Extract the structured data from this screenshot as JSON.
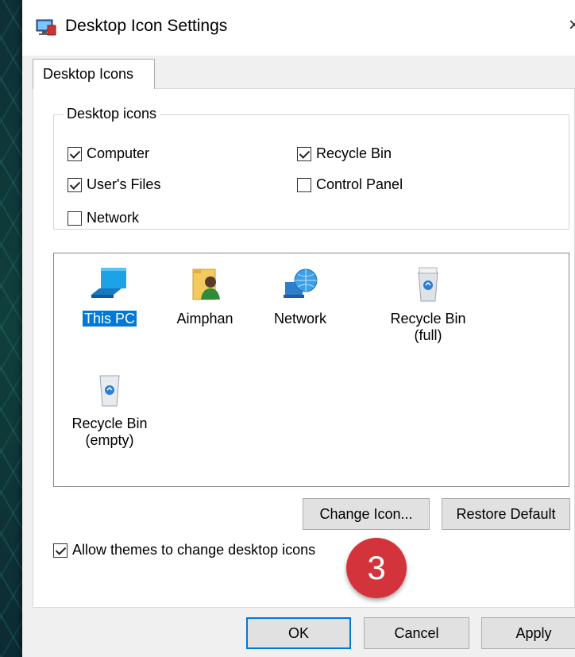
{
  "window": {
    "title": "Desktop Icon Settings",
    "close_glyph": "×"
  },
  "tab": {
    "label": "Desktop Icons"
  },
  "desktop_icons_group": {
    "title": "Desktop icons",
    "checkboxes": [
      {
        "label": "Computer",
        "checked": true
      },
      {
        "label": "User's Files",
        "checked": true
      },
      {
        "label": "Network",
        "checked": false
      },
      {
        "label": "Recycle Bin",
        "checked": true
      },
      {
        "label": "Control Panel",
        "checked": false
      }
    ]
  },
  "icon_list": {
    "items": [
      {
        "label": "This PC",
        "icon": "computer-icon",
        "selected": true
      },
      {
        "label": "Aimphan",
        "icon": "user-folder-icon"
      },
      {
        "label": "Network",
        "icon": "network-globe-icon"
      },
      {
        "label": "Recycle Bin\n(full)",
        "icon": "recycle-bin-full-icon"
      },
      {
        "label": "Recycle Bin\n(empty)",
        "icon": "recycle-bin-empty-icon"
      }
    ]
  },
  "buttons": {
    "change_icon": "Change Icon...",
    "restore_default": "Restore Default",
    "ok": "OK",
    "cancel": "Cancel",
    "apply": "Apply"
  },
  "allow_themes": {
    "label": "Allow themes to change desktop icons",
    "checked": true
  },
  "annotation": {
    "step": "3",
    "color": "#d3333a"
  }
}
